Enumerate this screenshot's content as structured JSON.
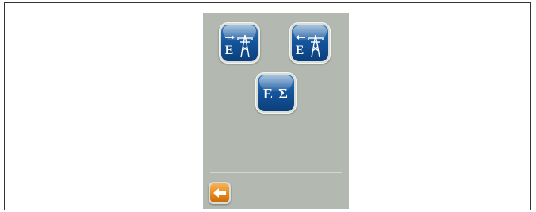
{
  "screen": {
    "buttons": [
      {
        "letter": "E",
        "arrow_direction": "right",
        "icon": "power-pylon-icon"
      },
      {
        "letter": "E",
        "arrow_direction": "left",
        "icon": "power-pylon-icon"
      },
      {
        "letter": "E",
        "symbol": "Σ",
        "icon": "sigma-icon"
      }
    ],
    "back_button": {
      "icon": "left-arrow-icon"
    }
  },
  "colors": {
    "button_blue": "#14559c",
    "back_orange": "#e68a1c",
    "panel_gray": "#b3b9b1"
  }
}
